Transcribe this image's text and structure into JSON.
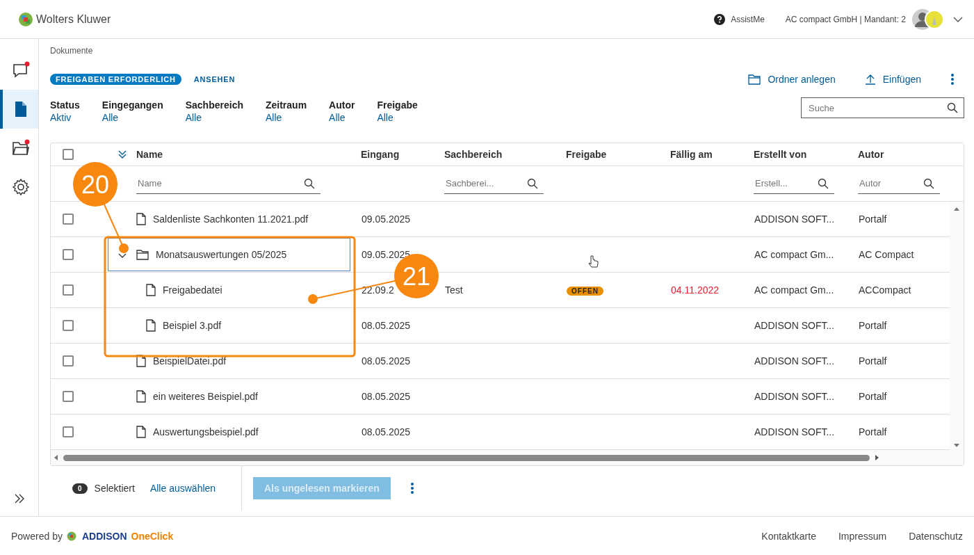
{
  "header": {
    "brand": "Wolters Kluwer",
    "assist": "AssistMe",
    "account": "AC compact GmbH | Mandant: 2"
  },
  "sidebar": {
    "items": [
      {
        "kind": "chat",
        "selected": false,
        "notification": true
      },
      {
        "kind": "document",
        "selected": true,
        "notification": false
      },
      {
        "kind": "folder",
        "selected": false,
        "notification": true
      },
      {
        "kind": "settings",
        "selected": false,
        "notification": false
      }
    ]
  },
  "breadcrumb": "Dokumente",
  "tabs": [
    {
      "label": "FREIGABEN ERFORDERLICH",
      "selected": true
    },
    {
      "label": "ANSEHEN",
      "selected": false
    }
  ],
  "actions": [
    {
      "kind": "folder",
      "label": "Ordner anlegen"
    },
    {
      "kind": "upload",
      "label": "Einfügen"
    }
  ],
  "filters": [
    {
      "label": "Status",
      "value": "Aktiv"
    },
    {
      "label": "Eingegangen",
      "value": "Alle"
    },
    {
      "label": "Sachbereich",
      "value": "Alle"
    },
    {
      "label": "Zeitraum",
      "value": "Alle"
    },
    {
      "label": "Autor",
      "value": "Alle"
    },
    {
      "label": "Freigabe",
      "value": "Alle"
    }
  ],
  "search": {
    "placeholder": "Suche"
  },
  "table": {
    "select_all_checked": false,
    "columns": [
      {
        "label": "Name",
        "filter_placeholder": "Name"
      },
      {
        "label": "Eingang"
      },
      {
        "label": "Sachbereich",
        "filter_placeholder": "Sachberei..."
      },
      {
        "label": "Freigabe"
      },
      {
        "label": "Fällig am"
      },
      {
        "label": "Erstellt von",
        "filter_placeholder": "Erstell..."
      },
      {
        "label": "Autor",
        "filter_placeholder": "Autor"
      }
    ],
    "rows": [
      {
        "kind": "file",
        "name": "Saldenliste Sachkonten 11.2021.pdf",
        "eingang": "09.05.2025",
        "erstellt_von": "ADDISON SOFT...",
        "autor": "Portalf",
        "checked": false,
        "focused": false
      },
      {
        "kind": "folder",
        "name": "Monatsauswertungen 05/2025",
        "eingang": "09.05.2025",
        "erstellt_von": "AC compact Gm...",
        "autor": "AC Compact",
        "checked": false,
        "focused": true,
        "expanded": true,
        "children": [
          {
            "kind": "file",
            "name": "Freigabedatei",
            "eingang": "22.09.2",
            "sachbereich": "Test",
            "freigabe": "OFFEN",
            "faellig_am": {
              "text": "04.11.2022",
              "overdue": true
            },
            "erstellt_von": "AC compact Gm...",
            "autor": "ACCompact",
            "checked": false,
            "focused": false
          },
          {
            "kind": "file",
            "name": "Beispiel 3.pdf",
            "eingang": "08.05.2025",
            "erstellt_von": "ADDISON SOFT...",
            "autor": "Portalf",
            "checked": false,
            "focused": false
          }
        ]
      },
      {
        "kind": "file",
        "name": "BeispielDatei.pdf",
        "eingang": "08.05.2025",
        "erstellt_von": "ADDISON SOFT...",
        "autor": "Portalf",
        "checked": false,
        "focused": false
      },
      {
        "kind": "file",
        "name": "ein weiteres Beispiel.pdf",
        "eingang": "08.05.2025",
        "erstellt_von": "ADDISON SOFT...",
        "autor": "Portalf",
        "checked": false,
        "focused": false
      },
      {
        "kind": "file",
        "name": "Auswertungsbeispiel.pdf",
        "eingang": "08.05.2025",
        "erstellt_von": "ADDISON SOFT...",
        "autor": "Portalf",
        "checked": false,
        "focused": false
      }
    ]
  },
  "selection": {
    "count": "0",
    "label": "Selektiert",
    "select_all": "Alle auswählen",
    "button": {
      "label": "Als ungelesen markieren",
      "disabled": true
    }
  },
  "footer": {
    "powered": "Powered by",
    "brand": "ADDISON",
    "product": "OneClick",
    "links": [
      "Kontaktkarte",
      "Impressum",
      "Datenschutz"
    ]
  },
  "callouts": [
    {
      "label": "20"
    },
    {
      "label": "21"
    }
  ]
}
